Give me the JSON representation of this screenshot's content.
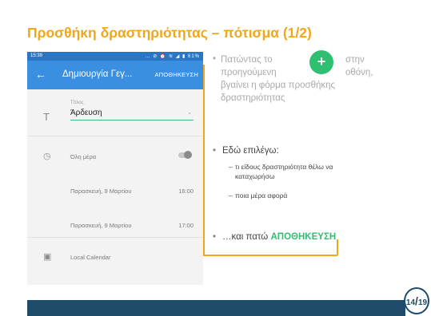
{
  "slide": {
    "title": "Προσθήκη δραστηριότητας – πότισμα (1/2)",
    "page_number": "14",
    "page_total": "19",
    "accent_color": "#f2a618",
    "footer_color": "#1d4b68"
  },
  "phone": {
    "status_time": "15:39",
    "status_icons": "… ⊘ ⏰ ≋ ◢ ▮ 61%",
    "appbar_title": "Δημιουργία Γεγ...",
    "appbar_save": "ΑΠΟΘΗΚΕΥΣΗ",
    "title_label": "Τίτλος",
    "title_value": "Άρδευση",
    "all_day_label": "Όλη μέρα",
    "start_date": "Παρασκευή, 9 Μαρτίου",
    "start_time": "16:00",
    "end_date": "Παρασκευή, 9 Μαρτίου",
    "end_time": "17:00",
    "calendar": "Local Calendar"
  },
  "notes": {
    "b1_line1": "Πατώντας το",
    "b1_line1b": "στην",
    "b1_line2": "προηγούμενη",
    "b1_line2b": "οθόνη,",
    "b1_line3": "βγαίνει η φόρμα προσθήκης",
    "b1_line4": "δραστηριότητας",
    "b2": "Εδώ επιλέγω:",
    "sub1_line1": "τι είδους δραστηριότητα θέλω να",
    "sub1_line2": "καταχωρήσω",
    "sub2": "ποια μέρα αφορά",
    "b3_prefix": "…και πατώ",
    "b3_highlight": "ΑΠΟΘΗΚΕΥΣΗ",
    "highlight_color": "#2fbf71"
  }
}
